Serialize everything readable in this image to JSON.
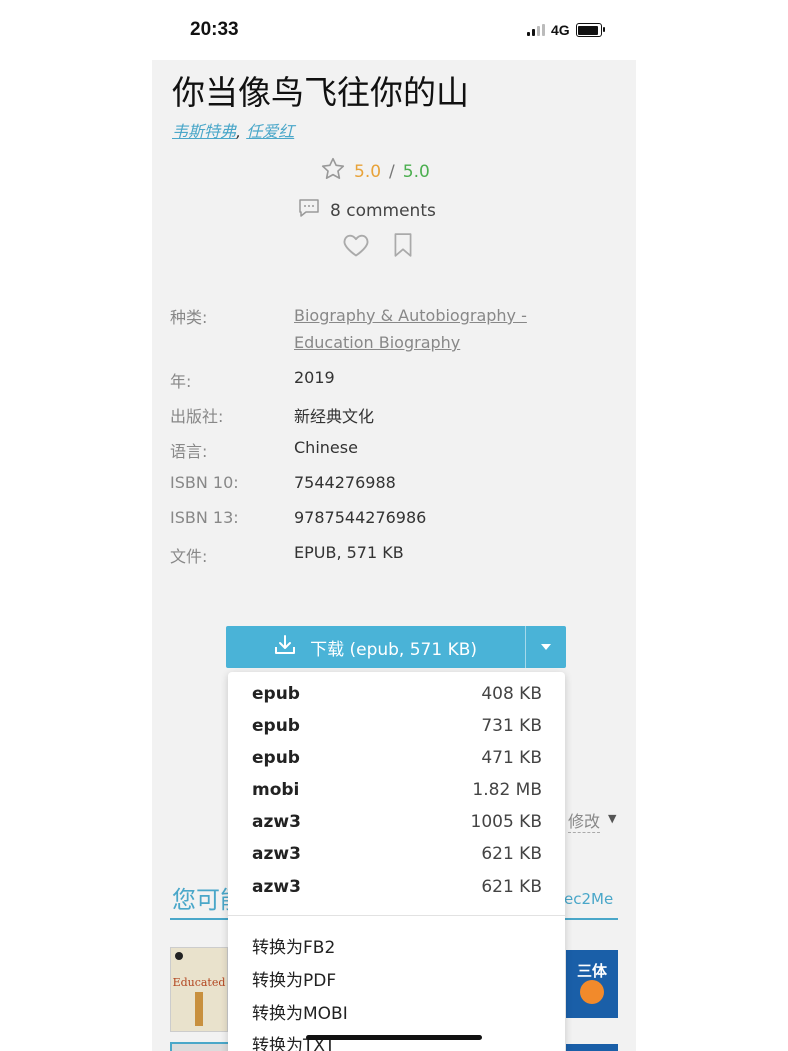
{
  "status_bar": {
    "time": "20:33",
    "network": "4G"
  },
  "book": {
    "title": "你当像鸟飞往你的山",
    "authors": [
      "韦斯特弗",
      "任爱红"
    ],
    "author_separator": ", ",
    "rating": {
      "score": "5.0",
      "separator": "/",
      "max": "5.0"
    },
    "comments": "8 comments"
  },
  "details": {
    "category_label": "种类:",
    "category_line1": "Biography & Autobiography -",
    "category_line2": "Education Biography",
    "year_label": "年:",
    "year": "2019",
    "publisher_label": "出版社:",
    "publisher": "新经典文化",
    "language_label": "语言:",
    "language": "Chinese",
    "isbn10_label": "ISBN 10:",
    "isbn10": "7544276988",
    "isbn13_label": "ISBN 13:",
    "isbn13": "9787544276986",
    "file_label": "文件:",
    "file": "EPUB, 571 KB"
  },
  "download": {
    "label": "下载 (epub, 571 KB)",
    "formats": [
      {
        "format": "epub",
        "size": "408 KB"
      },
      {
        "format": "epub",
        "size": "731 KB"
      },
      {
        "format": "epub",
        "size": "471 KB"
      },
      {
        "format": "mobi",
        "size": "1.82 MB"
      },
      {
        "format": "azw3",
        "size": "1005 KB"
      },
      {
        "format": "azw3",
        "size": "621 KB"
      },
      {
        "format": "azw3",
        "size": "621 KB"
      }
    ],
    "conversions": [
      "转换为FB2",
      "转换为PDF",
      "转换为MOBI",
      "转换为TXT"
    ]
  },
  "edit_label": "修改",
  "you_may_like": "您可能",
  "send_to": "ec2Me",
  "covers": {
    "educated_title": "Educated",
    "santi_title": "三体"
  },
  "colors": {
    "accent": "#4ab3d7",
    "rating_score": "#e8a33a",
    "rating_max": "#4caf50"
  }
}
